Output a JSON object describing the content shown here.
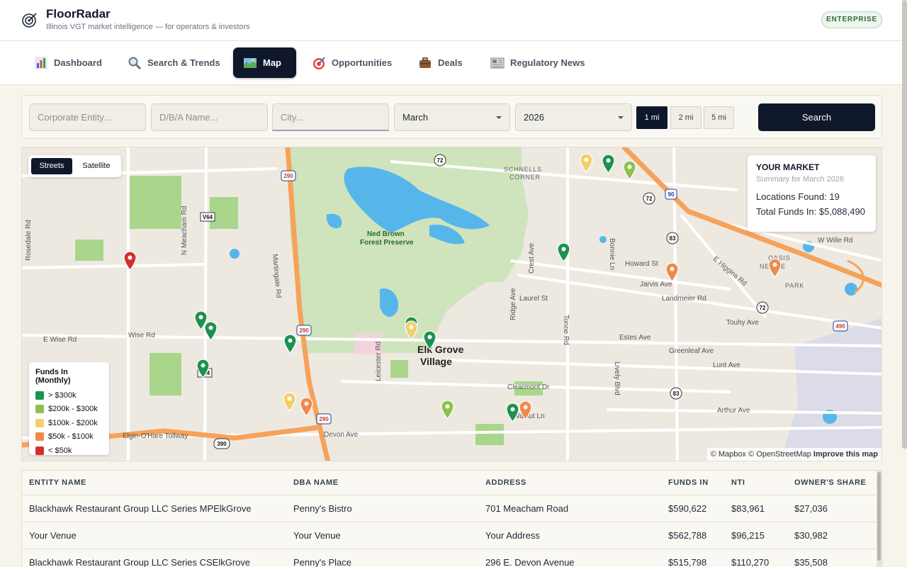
{
  "app": {
    "brand": "FloorRadar",
    "tagline": "Illinois VGT market intelligence — for operators & investors",
    "plan_badge": "ENTERPRISE"
  },
  "nav": {
    "tabs": [
      {
        "label": "Dashboard",
        "icon": "bar-chart-icon",
        "active": false
      },
      {
        "label": "Search & Trends",
        "icon": "magnifier-icon",
        "active": false
      },
      {
        "label": "Map",
        "icon": "map-icon",
        "active": true
      },
      {
        "label": "Opportunities",
        "icon": "target-icon",
        "active": false
      },
      {
        "label": "Deals",
        "icon": "briefcase-icon",
        "active": false
      },
      {
        "label": "Regulatory News",
        "icon": "newspaper-icon",
        "active": false
      }
    ]
  },
  "filters": {
    "corporate_placeholder": "Corporate Entity...",
    "dba_placeholder": "D/B/A Name...",
    "city_placeholder": "City...",
    "month": "March",
    "year": "2026",
    "radius_options": [
      "1 mi",
      "2 mi",
      "5 mi"
    ],
    "radius_selected": "1 mi",
    "search_label": "Search"
  },
  "map": {
    "view_toggle": [
      "Streets",
      "Satellite"
    ],
    "view_selected": "Streets",
    "summary": {
      "title": "YOUR MARKET",
      "subtitle": "Summary for March 2026",
      "locations_label": "Locations Found: 19",
      "funds_label": "Total Funds In: $5,088,490"
    },
    "legend": {
      "title": "Funds In (Monthly)",
      "items": [
        {
          "label": "> $300k",
          "color": "#1e9150"
        },
        {
          "label": "$200k - $300k",
          "color": "#8bc34a"
        },
        {
          "label": "$100k - $200k",
          "color": "#f2d06b"
        },
        {
          "label": "$50k - $100k",
          "color": "#f08a4b"
        },
        {
          "label": "< $50k",
          "color": "#d32f2f"
        }
      ]
    },
    "attribution": [
      "© Mapbox",
      "© OpenStreetMap",
      "Improve this map"
    ],
    "labels": [
      "Ned Brown",
      "Forest Preserve",
      "SCHNELLS",
      "CORNER",
      "OASIS",
      "NEBILE",
      "PARK",
      "Elk Grove",
      "Village",
      "Wise Rd",
      "E Wise Rd",
      "Elgin-O'Hare Tollway",
      "Devon Ave",
      "Touhy Ave",
      "Estes Ave",
      "Greenleaf Ave",
      "Lunt Ave",
      "Arthur Ave",
      "Howard St",
      "Jarvis Ave",
      "Landmeier Rd",
      "Laurel St",
      "Clearmont Dr",
      "Walnut Ln",
      "W Wille Rd",
      "N Meacham Rd",
      "Martingale Rd",
      "Leicester Rd",
      "Ridge Ave",
      "Tonne Rd",
      "Crest Ave",
      "Bonnie Ln",
      "Lively Blvd",
      "E Higgins Rd",
      "Rosedale Rd",
      "72",
      "83",
      "90",
      "290",
      "390",
      "V64"
    ]
  },
  "table": {
    "columns": [
      "ENTITY NAME",
      "DBA NAME",
      "ADDRESS",
      "FUNDS IN",
      "NTI",
      "OWNER'S SHARE"
    ],
    "rows": [
      [
        "Blackhawk Restaurant Group LLC Series MPElkGrove",
        "Penny's Bistro",
        "701 Meacham Road",
        "$590,622",
        "$83,961",
        "$27,036"
      ],
      [
        "Your Venue",
        "Your Venue",
        "Your Address",
        "$562,788",
        "$96,215",
        "$30,982"
      ],
      [
        "Blackhawk Restaurant Group LLC Series CSElkGrove",
        "Penny's Place",
        "296 E. Devon Avenue",
        "$515,798",
        "$110,270",
        "$35,508"
      ]
    ]
  }
}
